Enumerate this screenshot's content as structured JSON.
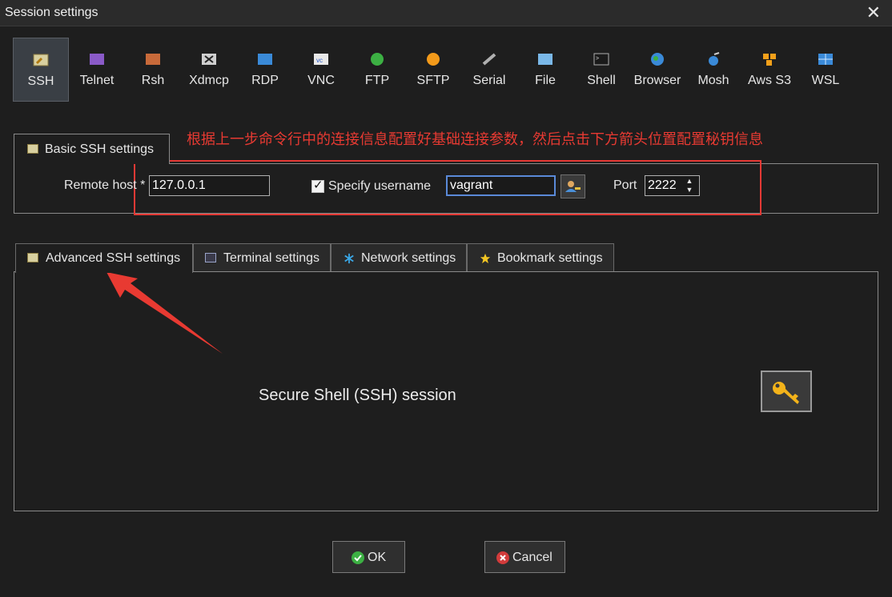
{
  "window": {
    "title": "Session settings",
    "close_glyph": "✕"
  },
  "protocols": [
    {
      "label": "SSH",
      "icon": "ssh-icon",
      "active": true
    },
    {
      "label": "Telnet",
      "icon": "telnet-icon"
    },
    {
      "label": "Rsh",
      "icon": "rsh-icon"
    },
    {
      "label": "Xdmcp",
      "icon": "xdmcp-icon"
    },
    {
      "label": "RDP",
      "icon": "rdp-icon"
    },
    {
      "label": "VNC",
      "icon": "vnc-icon"
    },
    {
      "label": "FTP",
      "icon": "ftp-icon"
    },
    {
      "label": "SFTP",
      "icon": "sftp-icon"
    },
    {
      "label": "Serial",
      "icon": "serial-icon"
    },
    {
      "label": "File",
      "icon": "file-icon"
    },
    {
      "label": "Shell",
      "icon": "shell-icon"
    },
    {
      "label": "Browser",
      "icon": "browser-icon"
    },
    {
      "label": "Mosh",
      "icon": "mosh-icon"
    },
    {
      "label": "Aws S3",
      "icon": "aws-s3-icon"
    },
    {
      "label": "WSL",
      "icon": "wsl-icon"
    }
  ],
  "basic": {
    "tab_label": "Basic SSH settings",
    "remote_host_label": "Remote host *",
    "remote_host_value": "127.0.0.1",
    "specify_username_label": "Specify username",
    "specify_username_checked": true,
    "username_value": "vagrant",
    "port_label": "Port",
    "port_value": "2222"
  },
  "annotation": {
    "text": "根据上一步命令行中的连接信息配置好基础连接参数，然后点击下方箭头位置配置秘钥信息",
    "color": "#e83a32"
  },
  "tabs": [
    {
      "label": "Advanced SSH settings",
      "icon": "wrench-icon",
      "active": true
    },
    {
      "label": "Terminal settings",
      "icon": "terminal-icon"
    },
    {
      "label": "Network settings",
      "icon": "network-icon"
    },
    {
      "label": "Bookmark settings",
      "icon": "star-icon"
    }
  ],
  "panel": {
    "description": "Secure Shell (SSH) session",
    "icon": "key-icon"
  },
  "buttons": {
    "ok": "OK",
    "cancel": "Cancel"
  },
  "colors": {
    "accent_red": "#e53935",
    "ok_green": "#3cb043",
    "cancel_red": "#d23b3b"
  }
}
